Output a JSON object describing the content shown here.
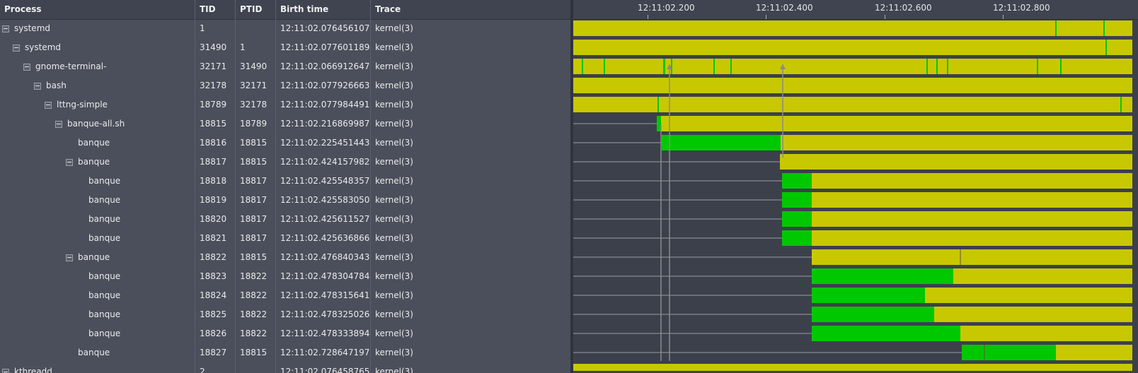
{
  "table": {
    "headers": {
      "process": "Process",
      "tid": "TID",
      "ptid": "PTID",
      "birth": "Birth time",
      "trace": "Trace"
    },
    "rows": [
      {
        "process": "systemd",
        "tid": "1",
        "ptid": "",
        "birth": "12:11:02.076456107",
        "trace": "kernel(3)",
        "depth": 0,
        "expander": true
      },
      {
        "process": "systemd",
        "tid": "31490",
        "ptid": "1",
        "birth": "12:11:02.077601189",
        "trace": "kernel(3)",
        "depth": 1,
        "expander": true
      },
      {
        "process": "gnome-terminal-",
        "tid": "32171",
        "ptid": "31490",
        "birth": "12:11:02.066912647",
        "trace": "kernel(3)",
        "depth": 2,
        "expander": true
      },
      {
        "process": "bash",
        "tid": "32178",
        "ptid": "32171",
        "birth": "12:11:02.077926663",
        "trace": "kernel(3)",
        "depth": 3,
        "expander": true
      },
      {
        "process": "lttng-simple",
        "tid": "18789",
        "ptid": "32178",
        "birth": "12:11:02.077984491",
        "trace": "kernel(3)",
        "depth": 4,
        "expander": true
      },
      {
        "process": "banque-all.sh",
        "tid": "18815",
        "ptid": "18789",
        "birth": "12:11:02.216869987",
        "trace": "kernel(3)",
        "depth": 5,
        "expander": true
      },
      {
        "process": "banque",
        "tid": "18816",
        "ptid": "18815",
        "birth": "12:11:02.225451443",
        "trace": "kernel(3)",
        "depth": 6,
        "expander": false
      },
      {
        "process": "banque",
        "tid": "18817",
        "ptid": "18815",
        "birth": "12:11:02.424157982",
        "trace": "kernel(3)",
        "depth": 6,
        "expander": true
      },
      {
        "process": "banque",
        "tid": "18818",
        "ptid": "18817",
        "birth": "12:11:02.425548357",
        "trace": "kernel(3)",
        "depth": 7,
        "expander": false
      },
      {
        "process": "banque",
        "tid": "18819",
        "ptid": "18817",
        "birth": "12:11:02.425583050",
        "trace": "kernel(3)",
        "depth": 7,
        "expander": false
      },
      {
        "process": "banque",
        "tid": "18820",
        "ptid": "18817",
        "birth": "12:11:02.425611527",
        "trace": "kernel(3)",
        "depth": 7,
        "expander": false
      },
      {
        "process": "banque",
        "tid": "18821",
        "ptid": "18817",
        "birth": "12:11:02.425636866",
        "trace": "kernel(3)",
        "depth": 7,
        "expander": false
      },
      {
        "process": "banque",
        "tid": "18822",
        "ptid": "18815",
        "birth": "12:11:02.476840343",
        "trace": "kernel(3)",
        "depth": 6,
        "expander": true
      },
      {
        "process": "banque",
        "tid": "18823",
        "ptid": "18822",
        "birth": "12:11:02.478304784",
        "trace": "kernel(3)",
        "depth": 7,
        "expander": false
      },
      {
        "process": "banque",
        "tid": "18824",
        "ptid": "18822",
        "birth": "12:11:02.478315641",
        "trace": "kernel(3)",
        "depth": 7,
        "expander": false
      },
      {
        "process": "banque",
        "tid": "18825",
        "ptid": "18822",
        "birth": "12:11:02.478325026",
        "trace": "kernel(3)",
        "depth": 7,
        "expander": false
      },
      {
        "process": "banque",
        "tid": "18826",
        "ptid": "18822",
        "birth": "12:11:02.478333894",
        "trace": "kernel(3)",
        "depth": 7,
        "expander": false
      },
      {
        "process": "banque",
        "tid": "18827",
        "ptid": "18815",
        "birth": "12:11:02.728647197",
        "trace": "kernel(3)",
        "depth": 6,
        "expander": false
      },
      {
        "process": "kthreadd",
        "tid": "2",
        "ptid": "",
        "birth": "12:11:02.076458765",
        "trace": "kernel(3)",
        "depth": 0,
        "expander": true
      }
    ]
  },
  "timeline": {
    "ticks": [
      "12:11:02.200",
      "12:11:02.400",
      "12:11:02.600",
      "12:11:02.800"
    ],
    "colors": {
      "running": "#00c800",
      "waiting": "#c8c800",
      "background": "#3c404b",
      "link": "#8a8a8a"
    }
  }
}
